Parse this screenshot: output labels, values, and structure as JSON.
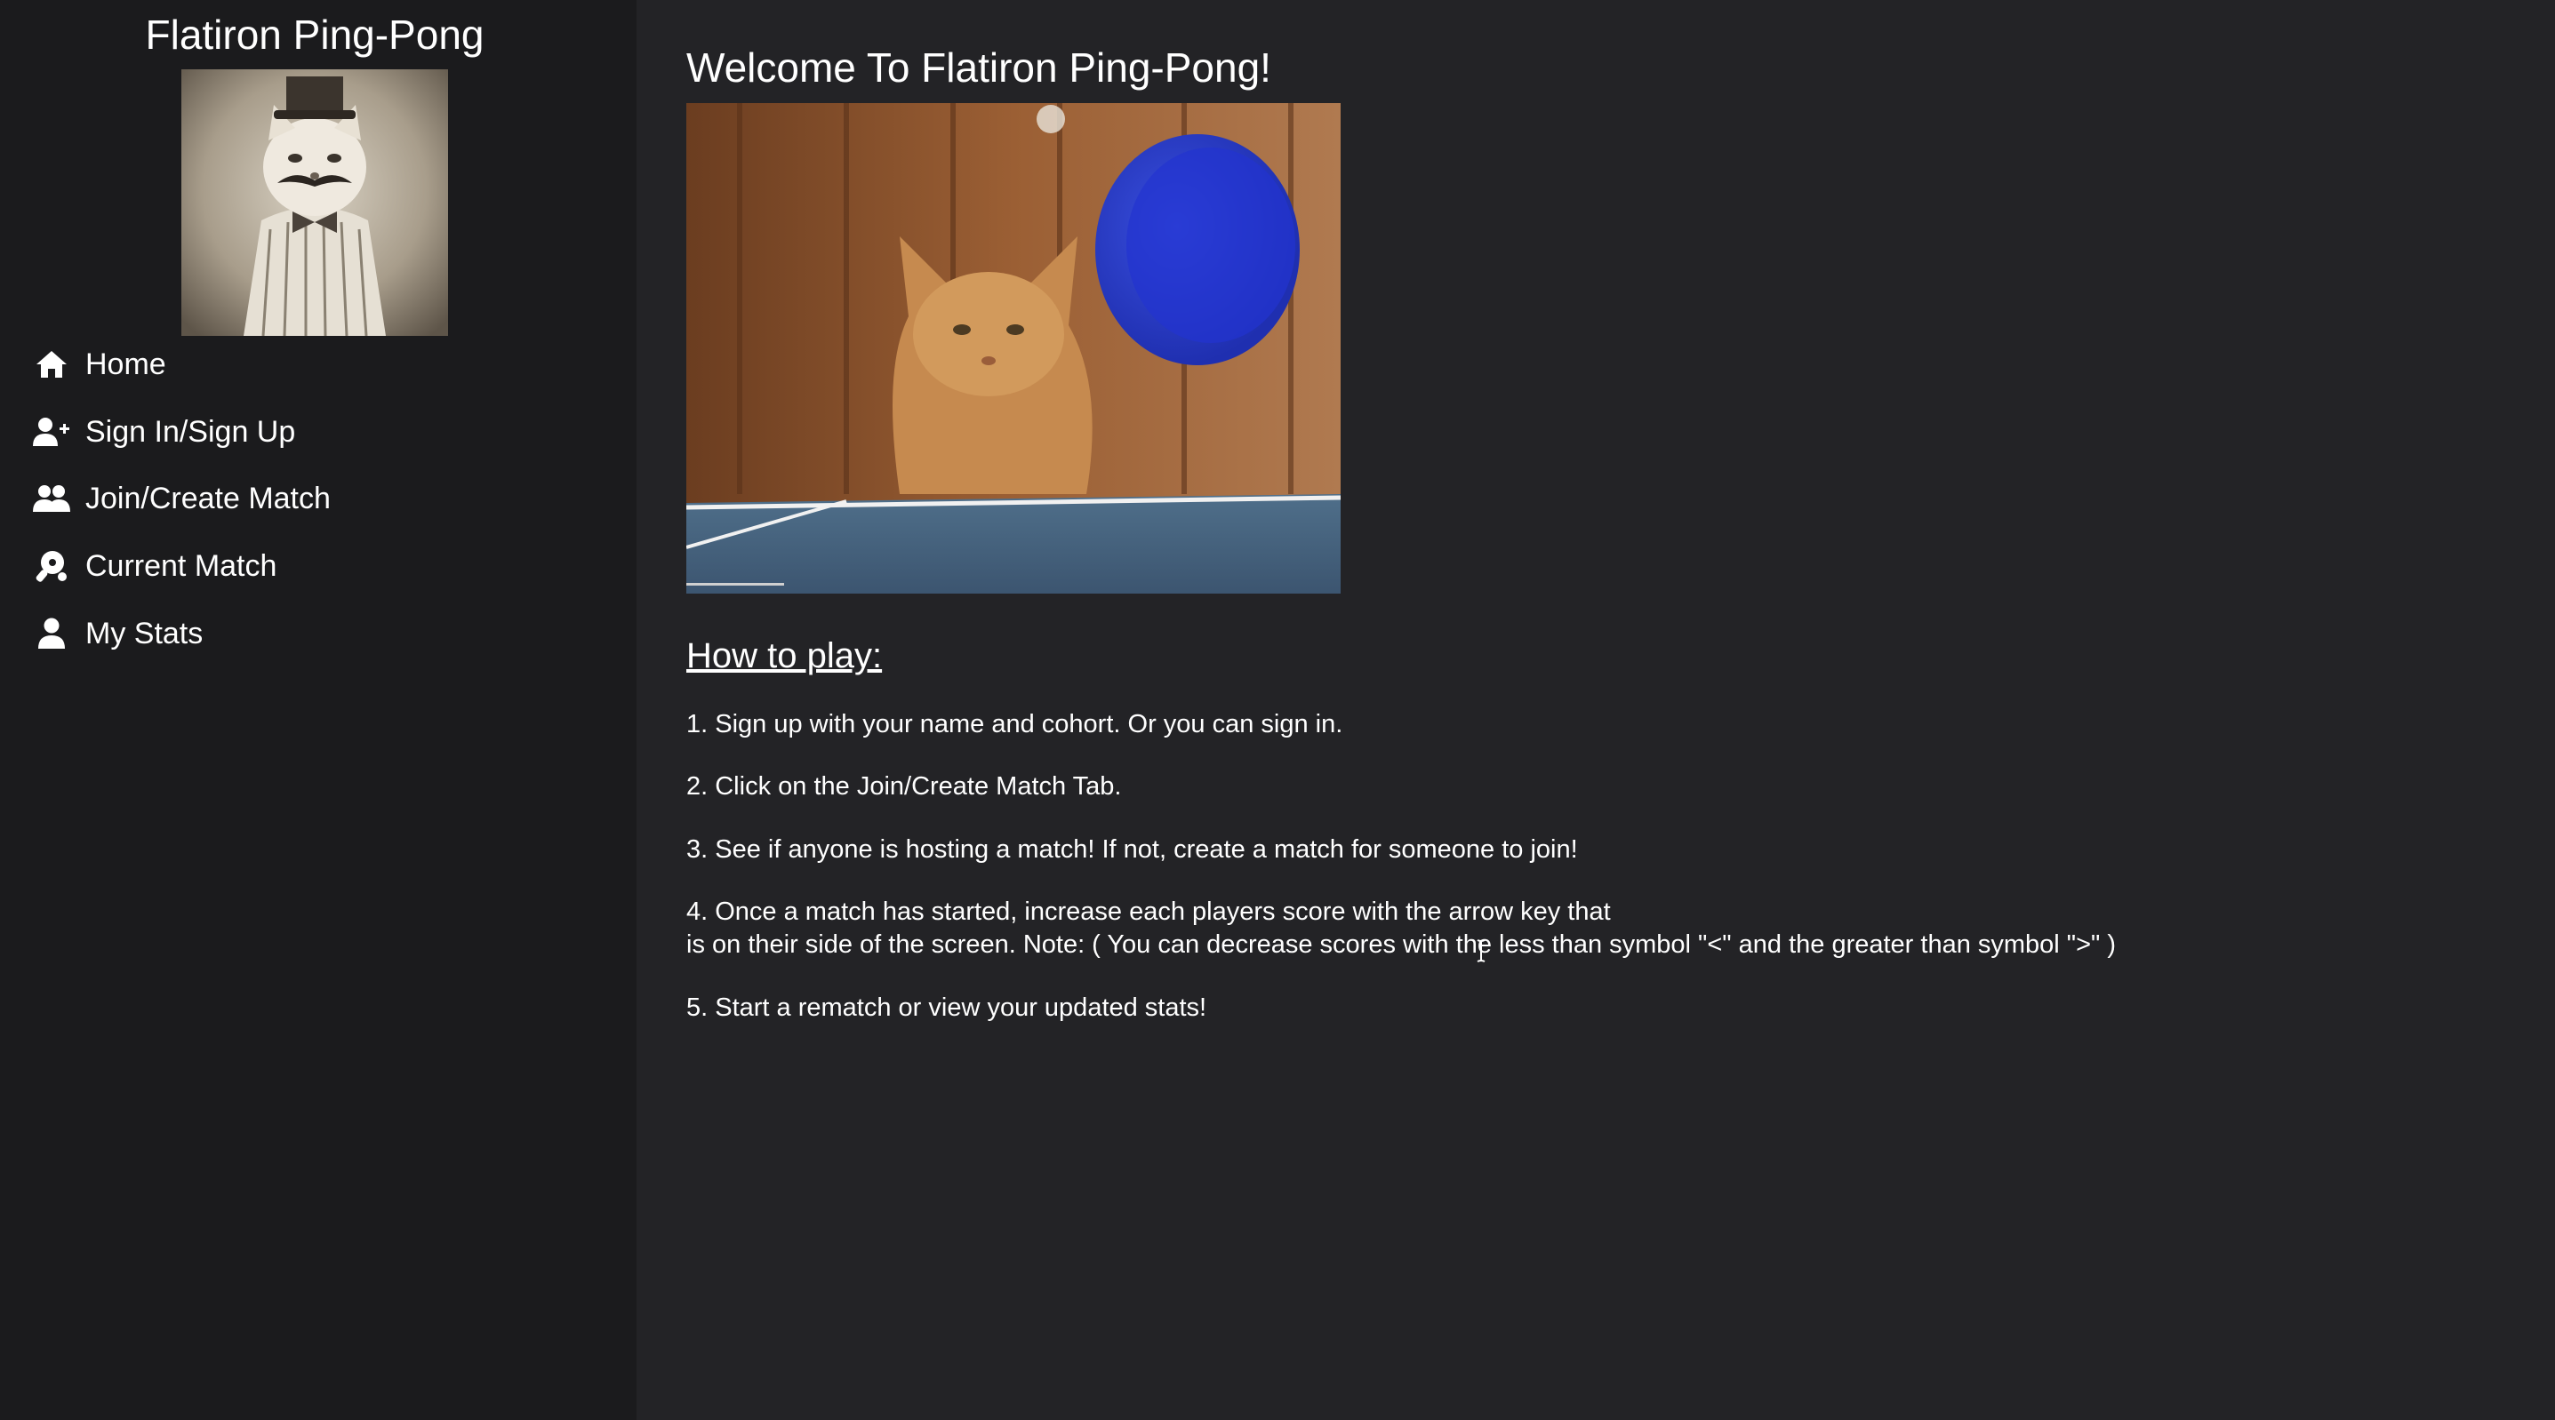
{
  "sidebar": {
    "title": "Flatiron Ping-Pong",
    "nav": [
      {
        "label": "Home",
        "icon": "home-icon"
      },
      {
        "label": "Sign In/Sign Up",
        "icon": "user-plus-icon"
      },
      {
        "label": "Join/Create Match",
        "icon": "users-icon"
      },
      {
        "label": "Current Match",
        "icon": "table-tennis-icon"
      },
      {
        "label": "My Stats",
        "icon": "user-icon"
      }
    ]
  },
  "main": {
    "welcome": "Welcome To Flatiron Ping-Pong!",
    "howto_heading": "How to play:",
    "steps": [
      "1. Sign up with your name and cohort. Or you can sign in.",
      "2. Click on the Join/Create Match Tab.",
      "3. See if anyone is hosting a match! If not, create a match for someone to join!",
      "4. Once a match has started, increase each players score with the arrow key that",
      "is on their side of the screen. Note: ( You can decrease scores with the less than symbol \"<\" and the greater than symbol \">\" )",
      "5. Start a rematch or view your updated stats!"
    ]
  },
  "colors": {
    "sidebar_bg": "#1b1b1d",
    "main_bg": "#232326",
    "text": "#ffffff"
  }
}
